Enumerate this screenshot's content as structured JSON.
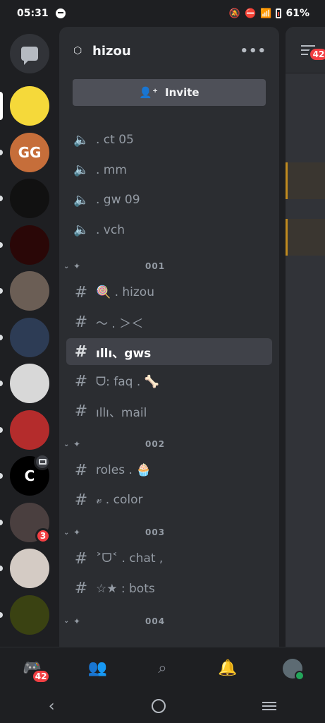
{
  "status_bar": {
    "time": "05:31",
    "battery": "61%"
  },
  "server": {
    "name": "hizou",
    "invite_label": "Invite",
    "more_label": "•••"
  },
  "rail": {
    "servers": [
      {
        "name": "bunny-server-icon",
        "color": "#f5d93a"
      },
      {
        "name": "gg-server-icon",
        "color": "#c66e3a",
        "text": "GG"
      },
      {
        "name": "bw-logo-server-icon",
        "color": "#111111"
      },
      {
        "name": "agency-server-icon",
        "color": "#2a0707"
      },
      {
        "name": "avatar-server-icon",
        "color": "#6b5e55"
      },
      {
        "name": "face-server-icon",
        "color": "#2d3c55"
      },
      {
        "name": "figure-server-icon",
        "color": "#d8d8d8"
      },
      {
        "name": "controller-server-icon",
        "color": "#b42c2c"
      },
      {
        "name": "c-server-icon",
        "color": "#000000",
        "text": "C"
      },
      {
        "name": "dark-server-icon",
        "color": "#4a3f3f",
        "badge": "3"
      },
      {
        "name": "person-server-icon",
        "color": "#d4cbc4"
      },
      {
        "name": "mad-dog-server-icon",
        "color": "#3a4212"
      }
    ]
  },
  "voice_channels": [
    ". ct 05",
    ". mm",
    ". gw 09",
    ". vch"
  ],
  "categories": [
    {
      "label": "001",
      "channels": [
        {
          "name": "🍭 . hizou"
        },
        {
          "name": "～ . ＞＜"
        },
        {
          "name": "ıllı、gws",
          "active": true
        },
        {
          "name": "ᗜ: faq . 🦴"
        },
        {
          "name": "ıllı、mail"
        }
      ]
    },
    {
      "label": "002",
      "channels": [
        {
          "name": "roles . 🧁"
        },
        {
          "name": "𝓋 . color"
        }
      ]
    },
    {
      "label": "003",
      "channels": [
        {
          "name": "˃ᗜ˂ . chat ,"
        },
        {
          "name": "☆★ : bots"
        }
      ]
    },
    {
      "label": "004",
      "channels": []
    }
  ],
  "peek": {
    "badge": "42"
  },
  "bottom_nav": {
    "home_badge": "42"
  }
}
